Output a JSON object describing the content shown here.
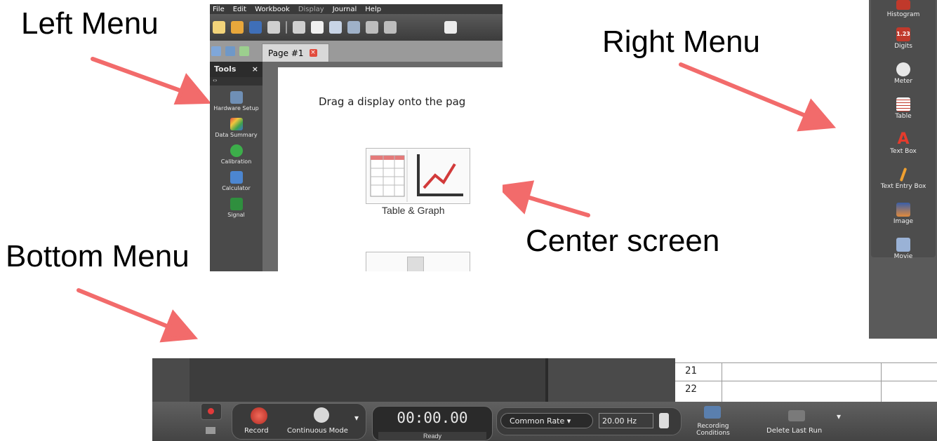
{
  "annotations": {
    "left_menu": "Left Menu",
    "right_menu": "Right Menu",
    "bottom_menu": "Bottom Menu",
    "center_screen": "Center screen"
  },
  "arrow_color": "#f26b6b",
  "app": {
    "menu": [
      "File",
      "Edit",
      "Workbook",
      "Display",
      "Journal",
      "Help"
    ],
    "tab_label": "Page #1",
    "tools_title": "Tools",
    "tools_close": "×",
    "tools_sub": "‹›",
    "tools": [
      {
        "label": "Hardware Setup",
        "icon": "hardware-icon"
      },
      {
        "label": "Data Summary",
        "icon": "data-summary-icon"
      },
      {
        "label": "Calibration",
        "icon": "calibration-icon"
      },
      {
        "label": "Calculator",
        "icon": "calculator-icon"
      },
      {
        "label": "Signal",
        "icon": "signal-icon"
      }
    ],
    "drag_message": "Drag a display onto the pag",
    "table_graph_label": "Table & Graph"
  },
  "right_menu": [
    {
      "label": "Histogram",
      "icon": "histogram-icon"
    },
    {
      "label": "Digits",
      "icon": "digits-icon",
      "glyph": "1.23"
    },
    {
      "label": "Meter",
      "icon": "meter-icon"
    },
    {
      "label": "Table",
      "icon": "table-icon"
    },
    {
      "label": "Text Box",
      "icon": "text-box-icon",
      "glyph": "A"
    },
    {
      "label": "Text Entry Box",
      "icon": "text-entry-icon"
    },
    {
      "label": "Image",
      "icon": "image-icon"
    },
    {
      "label": "Movie",
      "icon": "movie-icon"
    }
  ],
  "bottom": {
    "row_numbers": [
      "21",
      "22"
    ],
    "record_label": "Record",
    "mode_label": "Continuous Mode",
    "timer": "00:00.00",
    "status": "Ready",
    "rate_label": "Common Rate",
    "rate_value": "20.00 Hz",
    "conditions_label_1": "Recording",
    "conditions_label_2": "Conditions",
    "delete_label": "Delete Last Run"
  }
}
